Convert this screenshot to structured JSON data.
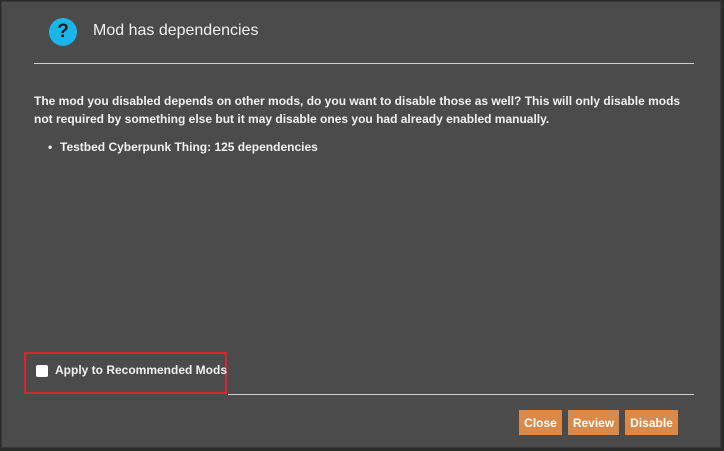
{
  "dialog": {
    "title": "Mod has dependencies",
    "icon": "question-icon",
    "message": "The mod you disabled depends on other mods, do you want to disable those as well? This will only disable mods not required by something else but it may disable ones you had already enabled manually.",
    "dependencies": [
      "Testbed Cyberpunk Thing: 125 dependencies"
    ],
    "checkbox": {
      "label": "Apply to Recommended Mods",
      "checked": false
    },
    "buttons": {
      "close": "Close",
      "review": "Review",
      "disable": "Disable"
    }
  },
  "colors": {
    "background": "#4b4b4b",
    "accent_button": "#d9894a",
    "icon": "#1ab5ea",
    "highlight": "#d9262e"
  }
}
